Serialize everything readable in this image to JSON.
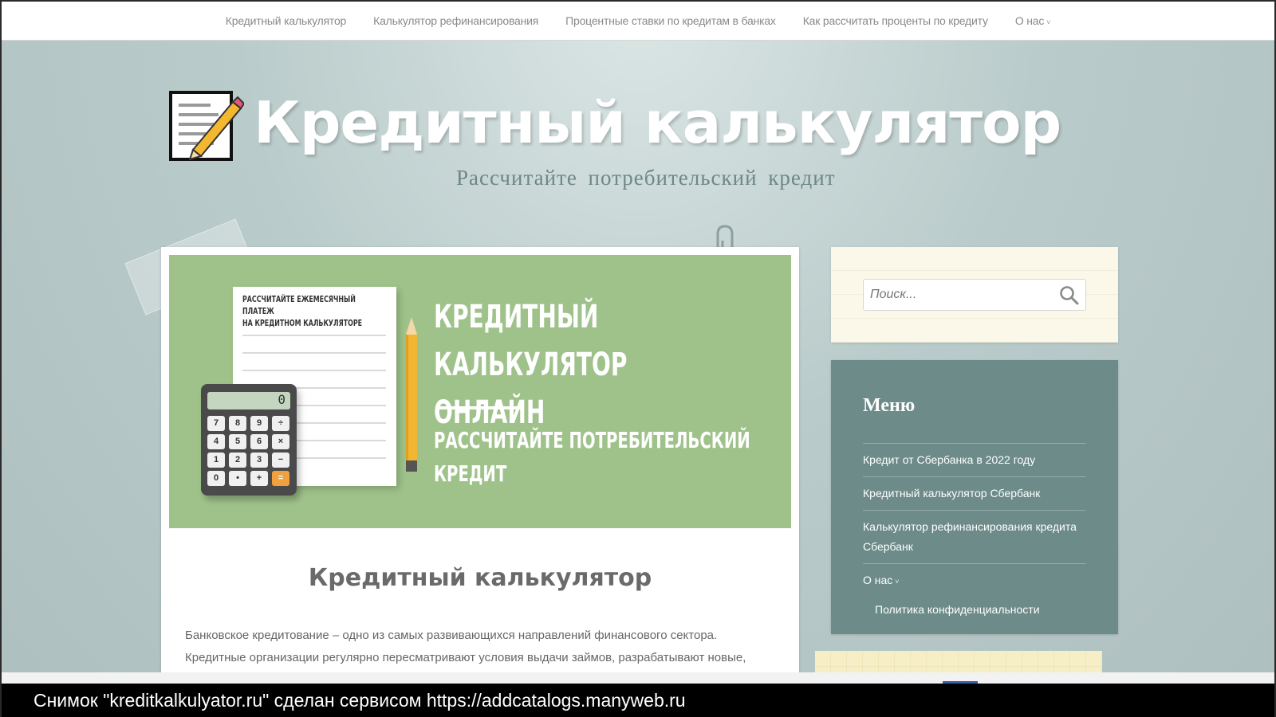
{
  "nav": {
    "items": [
      {
        "label": "Кредитный калькулятор"
      },
      {
        "label": "Калькулятор рефинансирования"
      },
      {
        "label": "Процентные ставки по кредитам в банках"
      },
      {
        "label": "Как рассчитать проценты по кредиту"
      },
      {
        "label": "О нас"
      }
    ],
    "dropdown_glyph": "˅"
  },
  "header": {
    "title": "Кредитный калькулятор",
    "tagline": "Рассчитайте потребительский кредит",
    "logo_icon": "notepad-pencil-icon"
  },
  "banner": {
    "paper_title_line1": "РАССЧИТАЙТЕ ЕЖЕМЕСЯЧНЫЙ ПЛАТЕЖ",
    "paper_title_line2": "НА КРЕДИТНОМ КАЛЬКУЛЯТОРЕ",
    "headline_line1": "КРЕДИТНЫЙ КАЛЬКУЛЯТОР",
    "headline_line2": "ОНЛАЙН",
    "subline_line1": "РАССЧИТАЙТЕ ПОТРЕБИТЕЛЬСКИЙ",
    "subline_line2": "КРЕДИТ",
    "calc_display": "0",
    "calc_keys": [
      "7",
      "8",
      "9",
      "÷",
      "4",
      "5",
      "6",
      "×",
      "1",
      "2",
      "3",
      "−",
      "0",
      "•",
      "+",
      "="
    ],
    "background_color": "#9fc28a"
  },
  "article": {
    "title": "Кредитный калькулятор",
    "text_line1": "Банковское кредитование – одно из самых развивающихся направлений финансового сектора.",
    "text_line2": "Кредитные организации регулярно пересматривают условия выдачи займов, разрабатывают новые,"
  },
  "search": {
    "placeholder": "Поиск...",
    "icon": "search-icon"
  },
  "menu": {
    "title": "Меню",
    "items": [
      {
        "label": "Кредит от Сбербанка в 2022 году"
      },
      {
        "label": "Кредитный калькулятор Сбербанк"
      },
      {
        "label": "Калькулятор рефинансирования кредита Сбербанк"
      },
      {
        "label": "О нас"
      },
      {
        "label": "Политика конфиденциальности"
      }
    ],
    "background_color": "#6c8b89"
  },
  "caption": {
    "text": "Снимок \"kreditkalkulyator.ru\" сделан сервисом https://addcatalogs.manyweb.ru"
  }
}
